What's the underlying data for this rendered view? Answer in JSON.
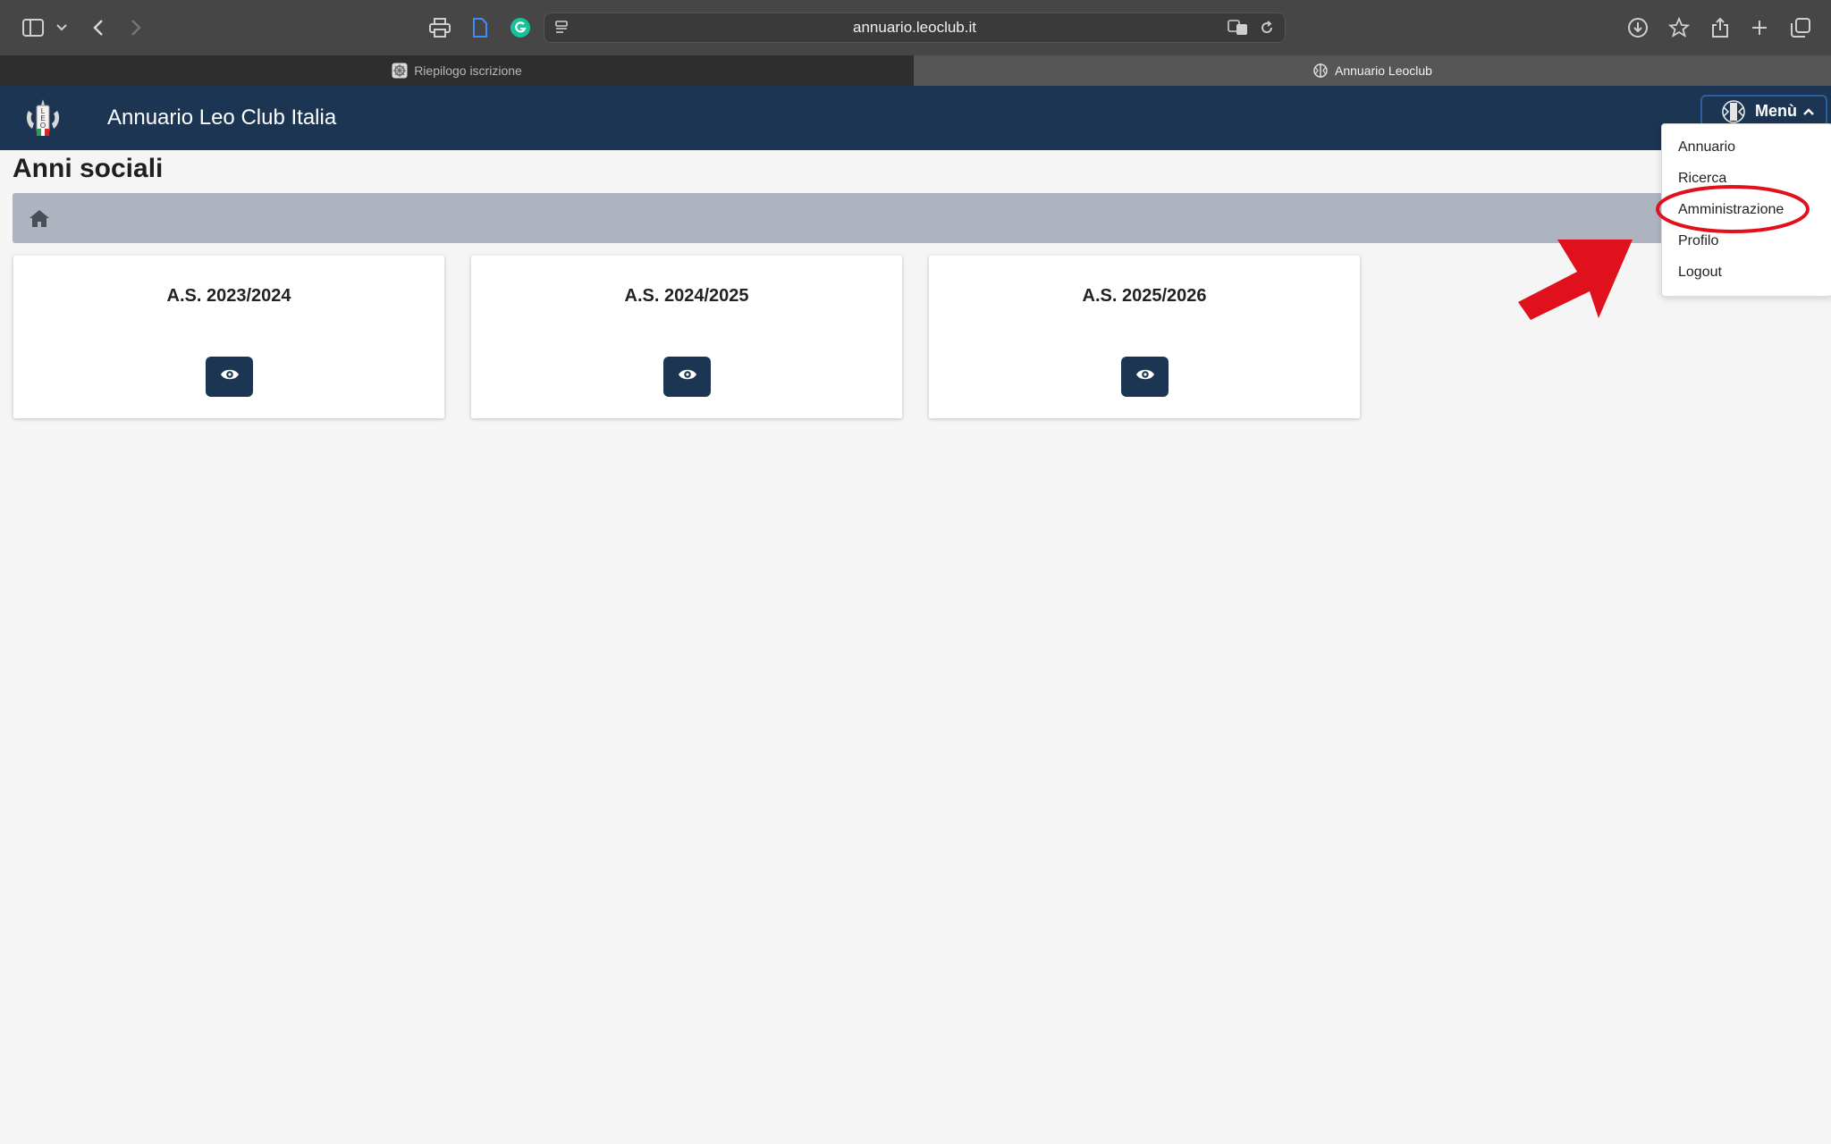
{
  "browser": {
    "url": "annuario.leoclub.it",
    "tabs": [
      {
        "label": "Riepilogo iscrizione",
        "active": false
      },
      {
        "label": "Annuario Leoclub",
        "active": true
      }
    ]
  },
  "app": {
    "title": "Annuario Leo Club Italia",
    "menu_label": "Menù",
    "colors": {
      "header": "#1b3553",
      "background": "#f5f5f5",
      "breadcrumb": "#adb4c0",
      "annotation": "#e0101c"
    }
  },
  "page": {
    "title": "Anni sociali",
    "cards": [
      {
        "title": "A.S. 2023/2024"
      },
      {
        "title": "A.S. 2024/2025"
      },
      {
        "title": "A.S. 2025/2026"
      }
    ]
  },
  "menu": {
    "items": [
      "Annuario",
      "Ricerca",
      "Amministrazione",
      "Profilo",
      "Logout"
    ],
    "highlighted": "Amministrazione"
  }
}
